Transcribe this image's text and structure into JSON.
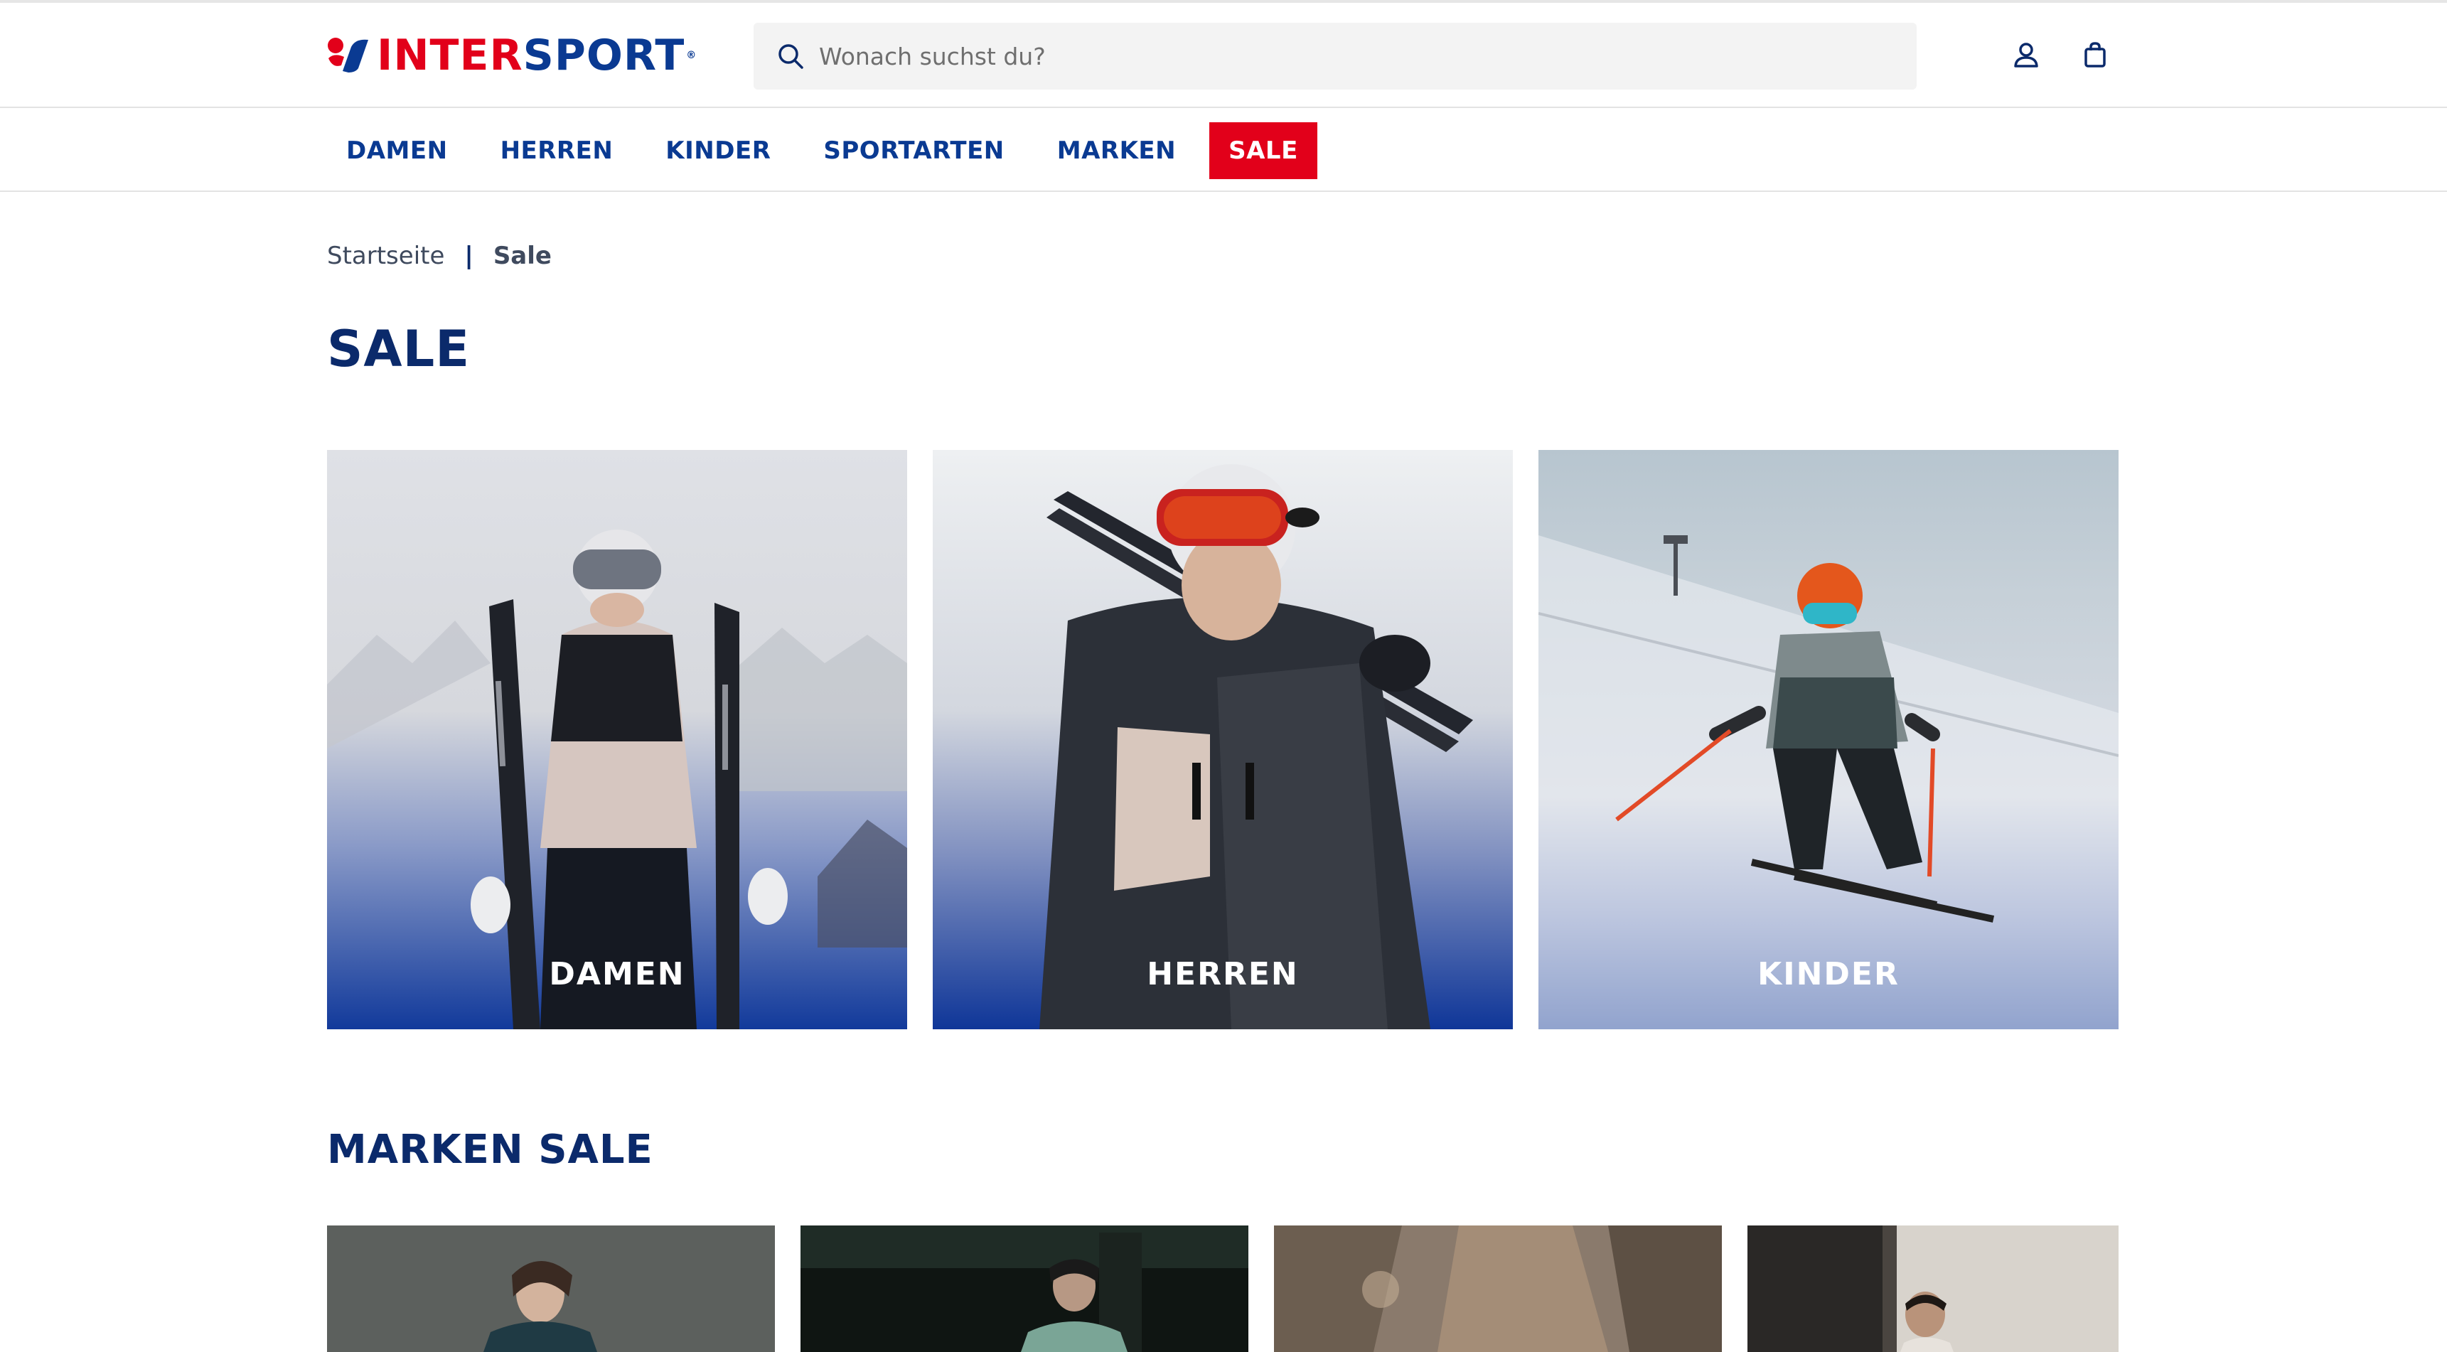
{
  "brand": {
    "name_part1": "INTER",
    "name_part2": "SPORT",
    "registered": "®",
    "color_red": "#e2001a",
    "color_blue": "#0a3a92"
  },
  "header": {
    "search_placeholder": "Wonach suchst du?",
    "search_icon": "search-icon",
    "account_icon": "user-icon",
    "cart_icon": "shopping-bag-icon"
  },
  "nav": {
    "items": [
      {
        "label": "DAMEN"
      },
      {
        "label": "HERREN"
      },
      {
        "label": "KINDER"
      },
      {
        "label": "SPORTARTEN"
      },
      {
        "label": "MARKEN"
      },
      {
        "label": "SALE",
        "highlight_color": "#e2001a"
      }
    ]
  },
  "breadcrumb": {
    "home": "Startseite",
    "separator": "|",
    "current": "Sale"
  },
  "page": {
    "title": "SALE"
  },
  "categories": [
    {
      "label": "DAMEN"
    },
    {
      "label": "HERREN"
    },
    {
      "label": "KINDER"
    }
  ],
  "brand_sale": {
    "title": "MARKEN SALE"
  }
}
